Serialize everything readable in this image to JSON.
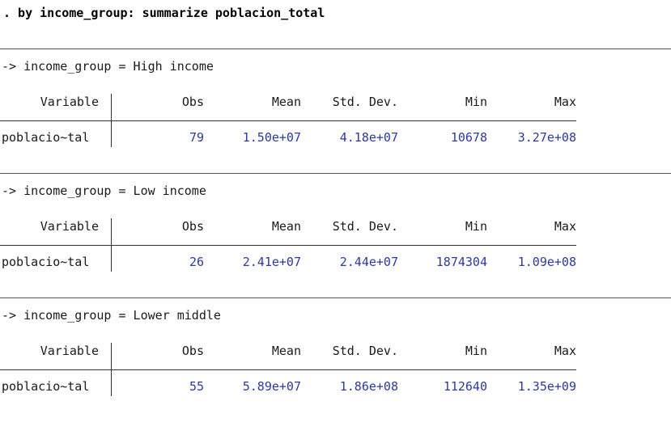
{
  "command": ". by income_group: summarize poblacion_total",
  "headers": {
    "variable": "Variable",
    "obs": "Obs",
    "mean": "Mean",
    "std_dev": "Std. Dev.",
    "min": "Min",
    "max": "Max"
  },
  "groups": [
    {
      "line": "-> income_group = High income",
      "row": {
        "variable": "poblacio~tal",
        "obs": "79",
        "mean": "1.50e+07",
        "std_dev": "4.18e+07",
        "min": "10678",
        "max": "3.27e+08"
      }
    },
    {
      "line": "-> income_group = Low income",
      "row": {
        "variable": "poblacio~tal",
        "obs": "26",
        "mean": "2.41e+07",
        "std_dev": "2.44e+07",
        "min": "1874304",
        "max": "1.09e+08"
      }
    },
    {
      "line": "-> income_group = Lower middle",
      "row": {
        "variable": "poblacio~tal",
        "obs": "55",
        "mean": "5.89e+07",
        "std_dev": "1.86e+08",
        "min": "112640",
        "max": "1.35e+09"
      }
    }
  ],
  "colors": {
    "result_text": "#2b3a9e",
    "plain_text": "#1a1a1a",
    "background": "#ffffff"
  }
}
